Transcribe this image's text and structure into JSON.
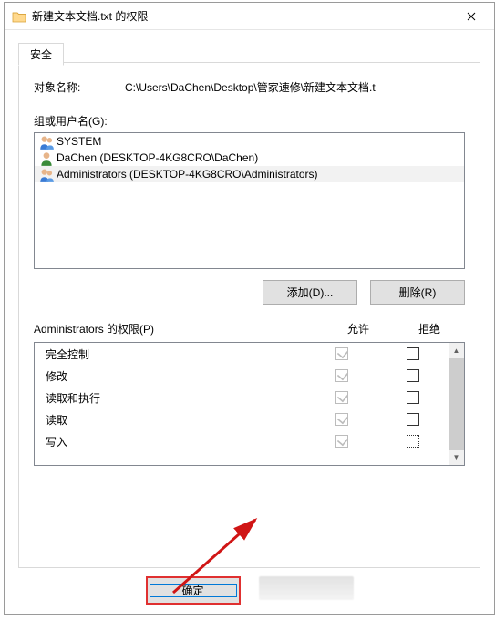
{
  "window": {
    "title": "新建文本文档.txt 的权限"
  },
  "tabs": {
    "security": "安全"
  },
  "object": {
    "label": "对象名称:",
    "path": "C:\\Users\\DaChen\\Desktop\\管家速修\\新建文本文档.t"
  },
  "groups": {
    "label": "组或用户名(G):",
    "items": [
      {
        "name": "SYSTEM",
        "iconType": "group"
      },
      {
        "name": "DaChen (DESKTOP-4KG8CRO\\DaChen)",
        "iconType": "user"
      },
      {
        "name": "Administrators (DESKTOP-4KG8CRO\\Administrators)",
        "iconType": "group"
      }
    ],
    "selectedIndex": 2
  },
  "buttons": {
    "add": "添加(D)...",
    "remove": "删除(R)",
    "ok": "确定"
  },
  "permissions": {
    "header": "Administrators 的权限(P)",
    "allow": "允许",
    "deny": "拒绝",
    "rows": [
      {
        "name": "完全控制",
        "allow": "grey",
        "deny": "empty"
      },
      {
        "name": "修改",
        "allow": "grey",
        "deny": "empty"
      },
      {
        "name": "读取和执行",
        "allow": "grey",
        "deny": "empty"
      },
      {
        "name": "读取",
        "allow": "grey",
        "deny": "empty"
      },
      {
        "name": "写入",
        "allow": "grey",
        "deny": "dotted"
      }
    ]
  }
}
